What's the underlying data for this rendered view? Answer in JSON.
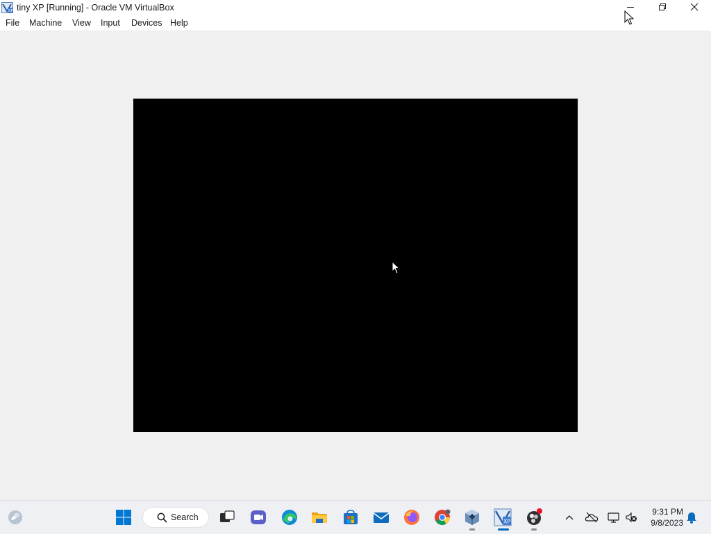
{
  "window": {
    "title": "tiny XP [Running] - Oracle VM VirtualBox",
    "icon": "virtualbox-xp-icon",
    "controls": [
      "minimize-icon",
      "restore-icon",
      "close-icon"
    ]
  },
  "menubar": {
    "items": [
      {
        "label": "File"
      },
      {
        "label": "Machine"
      },
      {
        "label": "View"
      },
      {
        "label": "Input"
      },
      {
        "label": "Devices"
      },
      {
        "label": "Help"
      }
    ]
  },
  "vm_display": {
    "background": "#000000"
  },
  "taskbar": {
    "search_label": "Search",
    "apps": [
      {
        "name": "widgets-icon"
      },
      {
        "name": "start-icon"
      },
      {
        "name": "search-icon"
      },
      {
        "name": "task-view-icon"
      },
      {
        "name": "teams-chat-icon"
      },
      {
        "name": "edge-icon"
      },
      {
        "name": "file-explorer-icon"
      },
      {
        "name": "microsoft-store-icon"
      },
      {
        "name": "mail-icon"
      },
      {
        "name": "firefox-icon"
      },
      {
        "name": "chrome-icon"
      },
      {
        "name": "virtualbox-icon"
      },
      {
        "name": "virtualbox-xp-vm-icon"
      },
      {
        "name": "obs-icon"
      }
    ],
    "tray": {
      "icons": [
        "chevron-up-icon",
        "onedrive-icon",
        "network-icon",
        "volume-muted-icon",
        "notification-bell-icon"
      ],
      "time": "9:31 PM",
      "date": "9/8/2023"
    }
  },
  "colors": {
    "accent": "#0067c0",
    "taskbar_bg": "#eef0f4",
    "window_bg": "#f0f0f0"
  }
}
